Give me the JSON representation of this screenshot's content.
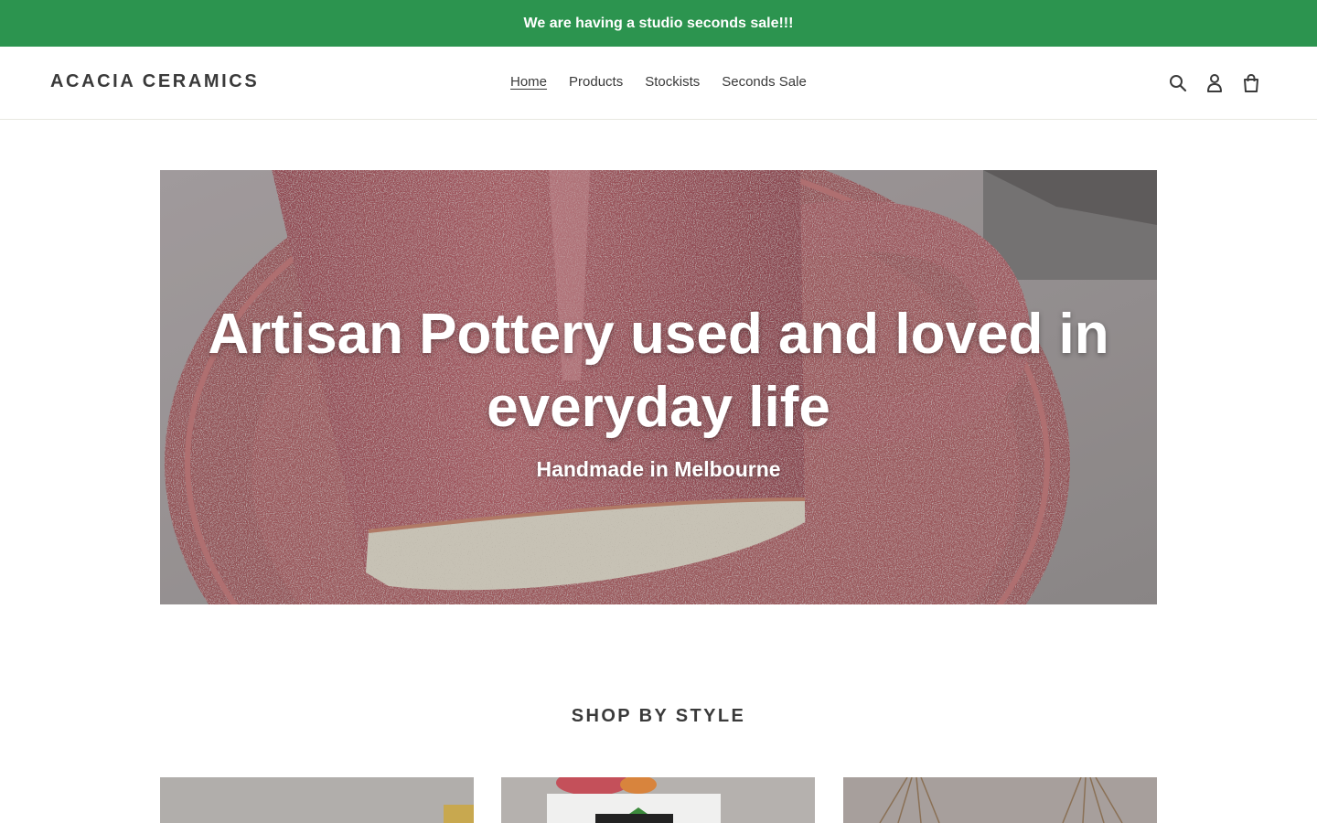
{
  "announcement": {
    "text": "We are having a studio seconds sale!!!"
  },
  "header": {
    "logo": "ACACIA CERAMICS",
    "nav": [
      {
        "label": "Home",
        "active": true
      },
      {
        "label": "Products",
        "active": false
      },
      {
        "label": "Stockists",
        "active": false
      },
      {
        "label": "Seconds Sale",
        "active": false
      }
    ],
    "icons": [
      "search-icon",
      "account-icon",
      "cart-icon"
    ]
  },
  "hero": {
    "title": "Artisan Pottery  used and loved in everyday life",
    "subtitle": "Handmade in Melbourne"
  },
  "shop_by_style": {
    "title": "SHOP BY STYLE"
  },
  "colors": {
    "announcement_bg": "#2c944f",
    "text": "#3a3a3a",
    "hero_overlay_text": "#ffffff"
  }
}
